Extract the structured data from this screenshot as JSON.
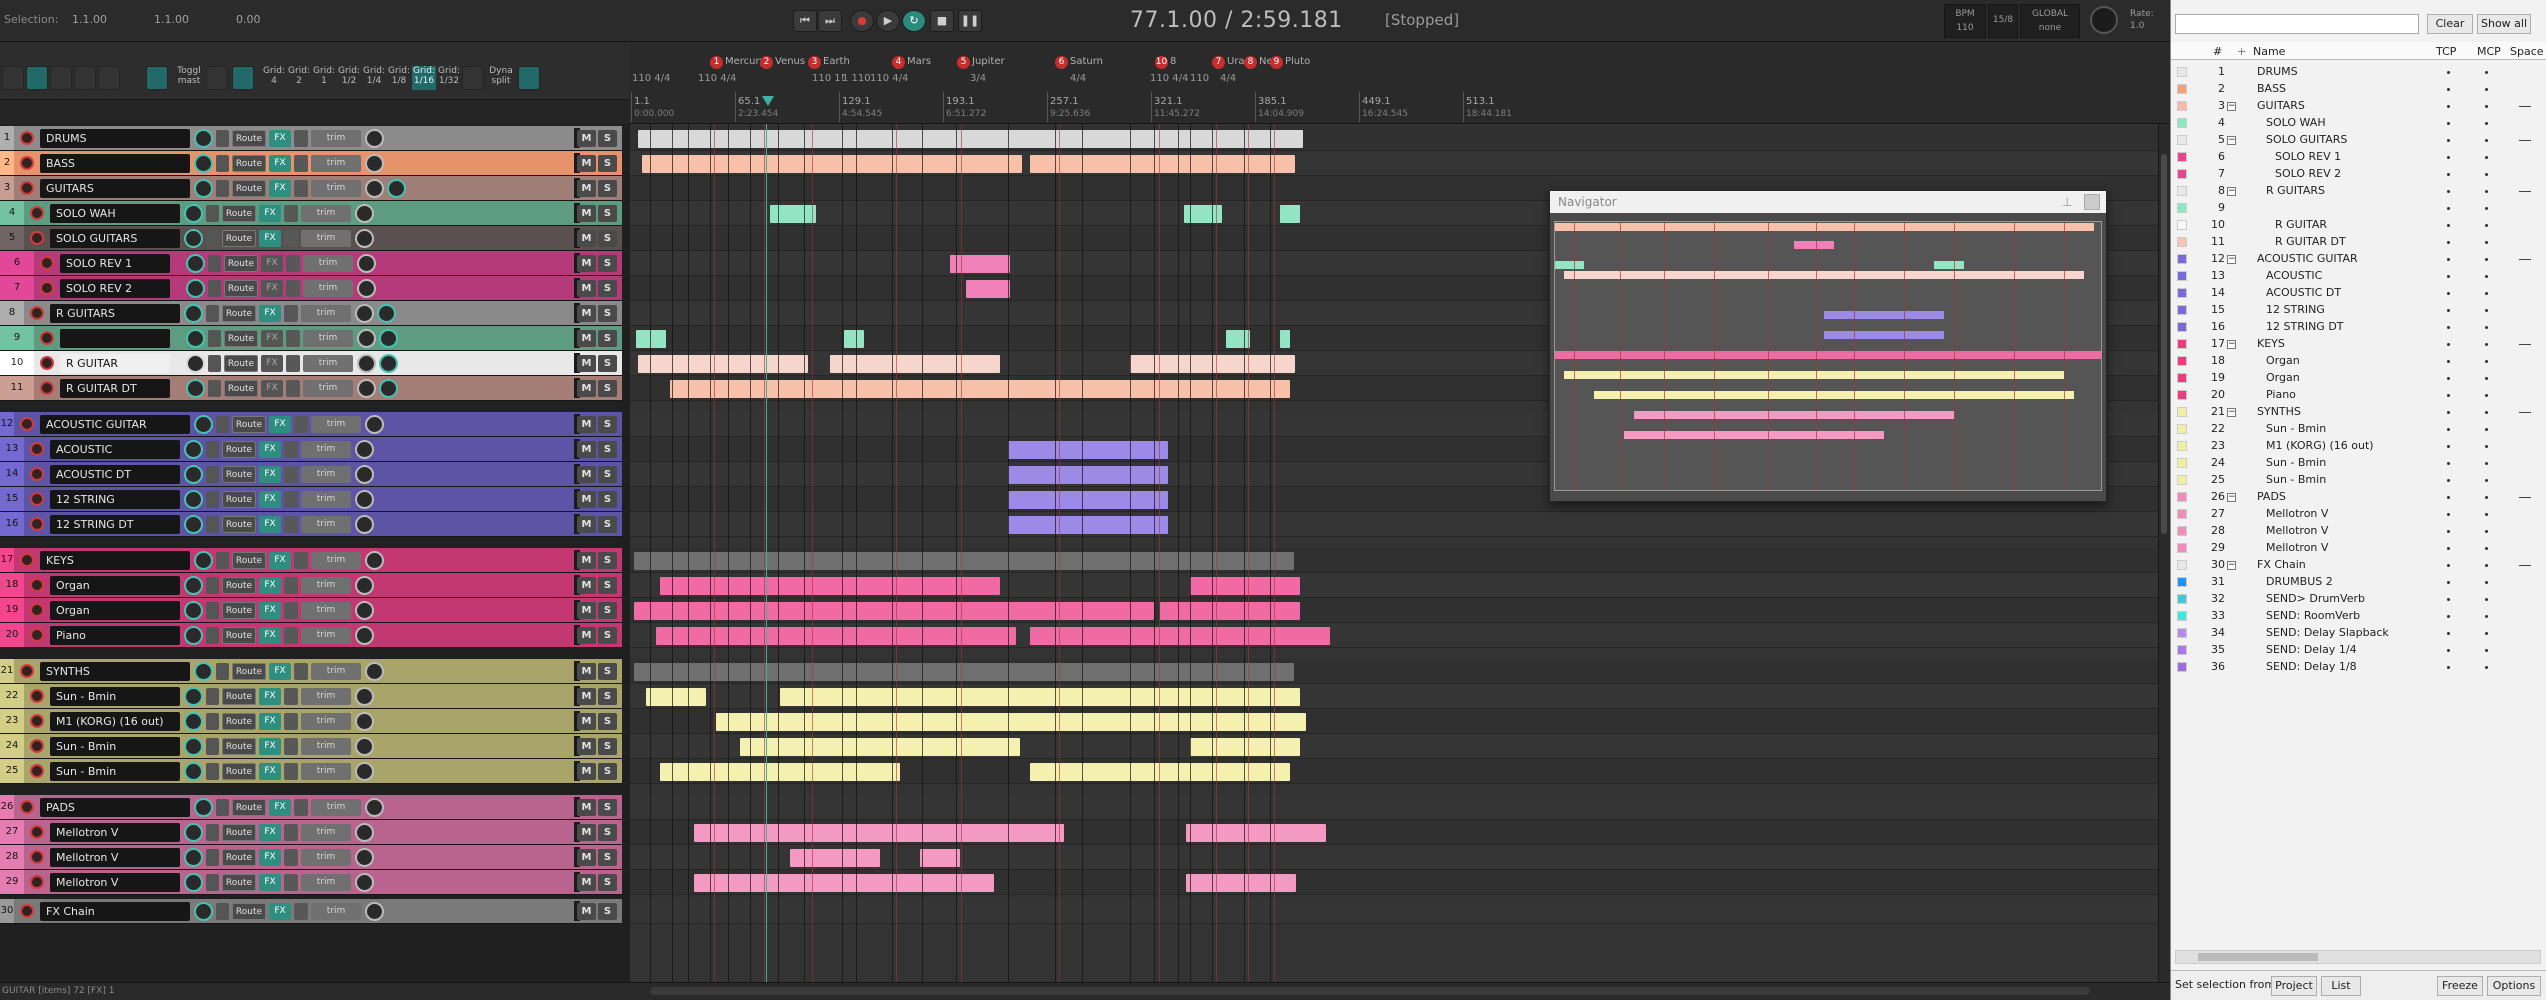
{
  "transport": {
    "selection_label": "Selection:",
    "sel_start": "1.1.00",
    "sel_end": "1.1.00",
    "sel_len": "0.00",
    "position": "77.1.00 / 2:59.181",
    "status": "[Stopped]",
    "bpm_label": "BPM",
    "bpm": "110",
    "timesig": "15/8",
    "global_label": "GLOBAL",
    "global_value": "none",
    "rate_label": "Rate:",
    "rate": "1.0"
  },
  "toolbar": {
    "toggle_master": "Toggl mast",
    "grids": [
      "Grid: 4",
      "Grid: 2",
      "Grid: 1",
      "Grid: 1/2",
      "Grid: 1/4",
      "Grid: 1/8",
      "Grid: 1/16",
      "Grid: 1/32"
    ],
    "dyna_split": "Dyna split"
  },
  "markers": [
    {
      "n": "1",
      "name": "Mercury"
    },
    {
      "n": "2",
      "name": "Venus"
    },
    {
      "n": "3",
      "name": "Earth"
    },
    {
      "n": "4",
      "name": "Mars"
    },
    {
      "n": "5",
      "name": "Jupiter"
    },
    {
      "n": "6",
      "name": "Saturn"
    },
    {
      "n": "10",
      "name": "8"
    },
    {
      "n": "7",
      "name": "Uran"
    },
    {
      "n": "8",
      "name": "Ne"
    },
    {
      "n": "9",
      "name": "Pluto"
    }
  ],
  "timesigs": [
    "110 4/4",
    "110 4/4",
    "110 1!",
    "1 110",
    "110 4/4",
    "3/4",
    "4/4",
    "110 4/4",
    "110",
    "4/4"
  ],
  "ruler_bars": [
    "1.1",
    "65.1",
    "129.1",
    "193.1",
    "257.1",
    "321.1",
    "385.1",
    "449.1",
    "513.1"
  ],
  "ruler_times": [
    "0:00.000",
    "2:23.454",
    "4:54.545",
    "6:51.272",
    "9:25.636",
    "11:45.272",
    "14:04.909",
    "16:24.545",
    "18:44.181"
  ],
  "tcp_labels": {
    "route": "Route",
    "fx": "FX",
    "trim": "trim",
    "mute": "M",
    "solo": "S"
  },
  "tracks": [
    {
      "n": "1",
      "name": "DRUMS",
      "color": "#8c8c8c",
      "depth": 0
    },
    {
      "n": "2",
      "name": "BASS",
      "color": "#e6936c",
      "depth": 0
    },
    {
      "n": "3",
      "name": "GUITARS",
      "color": "#9e7e76",
      "depth": 0
    },
    {
      "n": "4",
      "name": "SOLO WAH",
      "color": "#5d9c80",
      "depth": 1
    },
    {
      "n": "5",
      "name": "SOLO GUITARS",
      "color": "#5a5050",
      "depth": 1
    },
    {
      "n": "6",
      "name": "SOLO REV 1",
      "color": "#b53a79",
      "depth": 2
    },
    {
      "n": "7",
      "name": "SOLO REV 2",
      "color": "#b53a79",
      "depth": 2
    },
    {
      "n": "8",
      "name": "R GUITARS",
      "color": "#8a8a8a",
      "depth": 1
    },
    {
      "n": "9",
      "name": "",
      "color": "#5d9c80",
      "depth": 2
    },
    {
      "n": "10",
      "name": "R GUITAR",
      "color": "#e8e8e8",
      "depth": 2
    },
    {
      "n": "11",
      "name": "R GUITAR DT",
      "color": "#a47e76",
      "depth": 2
    },
    {
      "n": "12",
      "name": "ACOUSTIC GUITAR",
      "color": "#5d54a6",
      "depth": 0
    },
    {
      "n": "13",
      "name": "ACOUSTIC",
      "color": "#5d54a6",
      "depth": 1
    },
    {
      "n": "14",
      "name": "ACOUSTIC DT",
      "color": "#5d54a6",
      "depth": 1
    },
    {
      "n": "15",
      "name": "12 STRING",
      "color": "#5d54a6",
      "depth": 1
    },
    {
      "n": "16",
      "name": "12 STRING DT",
      "color": "#5d54a6",
      "depth": 1
    },
    {
      "n": "17",
      "name": "KEYS",
      "color": "#c33872",
      "depth": 0
    },
    {
      "n": "18",
      "name": "Organ",
      "color": "#c33872",
      "depth": 1
    },
    {
      "n": "19",
      "name": "Organ",
      "color": "#c33872",
      "depth": 1
    },
    {
      "n": "20",
      "name": "Piano",
      "color": "#c33872",
      "depth": 1
    },
    {
      "n": "21",
      "name": "SYNTHS",
      "color": "#a9a56a",
      "depth": 0
    },
    {
      "n": "22",
      "name": "Sun - Bmin",
      "color": "#a9a56a",
      "depth": 1
    },
    {
      "n": "23",
      "name": "M1 (KORG) (16 out)",
      "color": "#a9a56a",
      "depth": 1
    },
    {
      "n": "24",
      "name": "Sun - Bmin",
      "color": "#a9a56a",
      "depth": 1
    },
    {
      "n": "25",
      "name": "Sun - Bmin",
      "color": "#a9a56a",
      "depth": 1
    },
    {
      "n": "26",
      "name": "PADS",
      "color": "#b8648e",
      "depth": 0
    },
    {
      "n": "27",
      "name": "Mellotron V",
      "color": "#b8648e",
      "depth": 1
    },
    {
      "n": "28",
      "name": "Mellotron V",
      "color": "#b8648e",
      "depth": 1
    },
    {
      "n": "29",
      "name": "Mellotron V",
      "color": "#b8648e",
      "depth": 1
    },
    {
      "n": "30",
      "name": "FX Chain",
      "color": "#7a7a7a",
      "depth": 0
    }
  ],
  "bottom_status": "GUITAR [items] 72 [FX] 1",
  "navigator": {
    "title": "Navigator"
  },
  "track_manager": {
    "clear": "Clear",
    "show_all": "Show all",
    "cols": {
      "num": "#",
      "name": "Name",
      "tcp": "TCP",
      "mcp": "MCP",
      "space": "Space"
    },
    "rows": [
      {
        "n": "1",
        "name": "DRUMS",
        "color": "#e8e8e8",
        "depth": 0,
        "fold": ""
      },
      {
        "n": "2",
        "name": "BASS",
        "color": "#f4a07c",
        "depth": 0,
        "fold": ""
      },
      {
        "n": "3",
        "name": "GUITARS",
        "color": "#f8b9ad",
        "depth": 0,
        "fold": "−"
      },
      {
        "n": "4",
        "name": "SOLO WAH",
        "color": "#8ce8c0",
        "depth": 1,
        "fold": ""
      },
      {
        "n": "5",
        "name": "SOLO GUITARS",
        "color": "#e8e8e8",
        "depth": 1,
        "fold": "−"
      },
      {
        "n": "6",
        "name": "SOLO REV 1",
        "color": "#e64690",
        "depth": 2,
        "fold": ""
      },
      {
        "n": "7",
        "name": "SOLO REV 2",
        "color": "#e64690",
        "depth": 2,
        "fold": ""
      },
      {
        "n": "8",
        "name": "R GUITARS",
        "color": "#e8e8e8",
        "depth": 1,
        "fold": "−"
      },
      {
        "n": "9",
        "name": "",
        "color": "#8ce8c0",
        "depth": 2,
        "fold": ""
      },
      {
        "n": "10",
        "name": "R GUITAR",
        "color": "#f8f8f8",
        "depth": 2,
        "fold": ""
      },
      {
        "n": "11",
        "name": "R GUITAR DT",
        "color": "#f8c4b4",
        "depth": 2,
        "fold": ""
      },
      {
        "n": "12",
        "name": "ACOUSTIC GUITAR",
        "color": "#7a6ad8",
        "depth": 0,
        "fold": "−"
      },
      {
        "n": "13",
        "name": "ACOUSTIC",
        "color": "#7a6ad8",
        "depth": 1,
        "fold": ""
      },
      {
        "n": "14",
        "name": "ACOUSTIC DT",
        "color": "#7a6ad8",
        "depth": 1,
        "fold": ""
      },
      {
        "n": "15",
        "name": "12 STRING",
        "color": "#7a6ad8",
        "depth": 1,
        "fold": ""
      },
      {
        "n": "16",
        "name": "12 STRING DT",
        "color": "#7a6ad8",
        "depth": 1,
        "fold": ""
      },
      {
        "n": "17",
        "name": "KEYS",
        "color": "#e8407e",
        "depth": 0,
        "fold": "−"
      },
      {
        "n": "18",
        "name": "Organ",
        "color": "#e8407e",
        "depth": 1,
        "fold": ""
      },
      {
        "n": "19",
        "name": "Organ",
        "color": "#e8407e",
        "depth": 1,
        "fold": ""
      },
      {
        "n": "20",
        "name": "Piano",
        "color": "#e8407e",
        "depth": 1,
        "fold": ""
      },
      {
        "n": "21",
        "name": "SYNTHS",
        "color": "#f0f0a4",
        "depth": 0,
        "fold": "−"
      },
      {
        "n": "22",
        "name": "Sun - Bmin",
        "color": "#f0f0a4",
        "depth": 1,
        "fold": ""
      },
      {
        "n": "23",
        "name": "M1 (KORG) (16 out)",
        "color": "#f0f0a4",
        "depth": 1,
        "fold": ""
      },
      {
        "n": "24",
        "name": "Sun - Bmin",
        "color": "#f0f0a4",
        "depth": 1,
        "fold": ""
      },
      {
        "n": "25",
        "name": "Sun - Bmin",
        "color": "#f0f0a4",
        "depth": 1,
        "fold": ""
      },
      {
        "n": "26",
        "name": "PADS",
        "color": "#f08cb8",
        "depth": 0,
        "fold": "−"
      },
      {
        "n": "27",
        "name": "Mellotron V",
        "color": "#f08cb8",
        "depth": 1,
        "fold": ""
      },
      {
        "n": "28",
        "name": "Mellotron V",
        "color": "#f08cb8",
        "depth": 1,
        "fold": ""
      },
      {
        "n": "29",
        "name": "Mellotron V",
        "color": "#f08cb8",
        "depth": 1,
        "fold": ""
      },
      {
        "n": "30",
        "name": "FX Chain",
        "color": "#e8e8e8",
        "depth": 0,
        "fold": "−"
      },
      {
        "n": "31",
        "name": "DRUMBUS 2",
        "color": "#1e90ff",
        "depth": 1,
        "fold": ""
      },
      {
        "n": "32",
        "name": "SEND> DrumVerb",
        "color": "#44c8d8",
        "depth": 1,
        "fold": ""
      },
      {
        "n": "33",
        "name": "SEND: RoomVerb",
        "color": "#44e8e0",
        "depth": 1,
        "fold": ""
      },
      {
        "n": "34",
        "name": "SEND: Delay Slapback",
        "color": "#b48ce8",
        "depth": 1,
        "fold": ""
      },
      {
        "n": "35",
        "name": "SEND: Delay 1/4",
        "color": "#a878e8",
        "depth": 1,
        "fold": ""
      },
      {
        "n": "36",
        "name": "SEND: Delay 1/8",
        "color": "#9c6ce0",
        "depth": 1,
        "fold": ""
      }
    ],
    "footer_label": "Set selection from:",
    "project": "Project",
    "list": "List",
    "freeze": "Freeze",
    "options": "Options"
  }
}
